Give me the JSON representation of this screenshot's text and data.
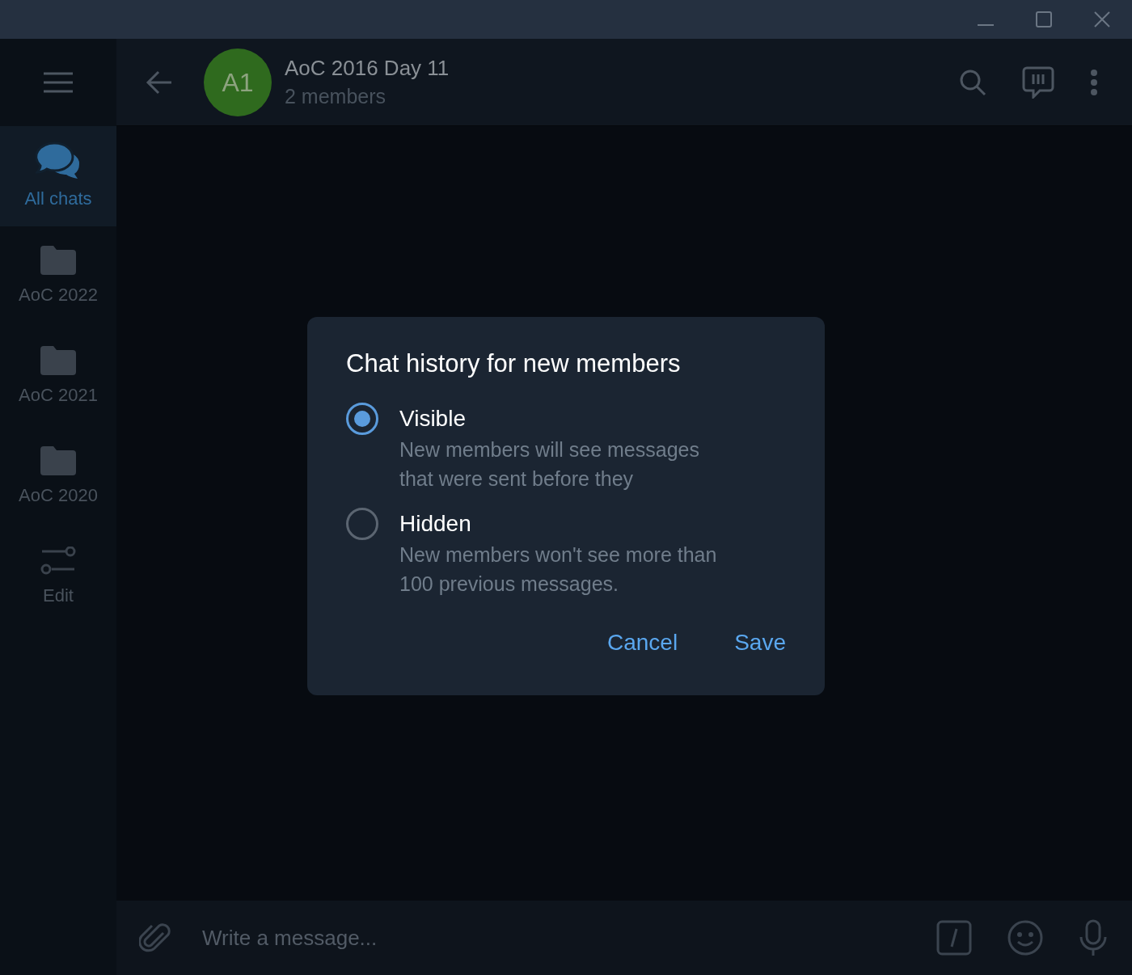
{
  "header": {
    "avatar": "A1",
    "title": "AoC 2016 Day 11",
    "subtitle": "2 members"
  },
  "sidebar": {
    "items": [
      {
        "label": "All chats",
        "kind": "chats",
        "selected": true
      },
      {
        "label": "AoC 2022",
        "kind": "folder",
        "selected": false
      },
      {
        "label": "AoC 2021",
        "kind": "folder",
        "selected": false
      },
      {
        "label": "AoC 2020",
        "kind": "folder",
        "selected": false
      },
      {
        "label": "Edit",
        "kind": "edit",
        "selected": false
      }
    ]
  },
  "dialog": {
    "title": "Chat history for new members",
    "options": [
      {
        "label": "Visible",
        "description": "New members will see messages that were sent before they",
        "selected": true
      },
      {
        "label": "Hidden",
        "description": "New members won't see more than 100 previous messages.",
        "selected": false
      }
    ],
    "buttons": [
      "Cancel",
      "Save"
    ]
  },
  "composer": {
    "placeholder": "Write a message..."
  }
}
